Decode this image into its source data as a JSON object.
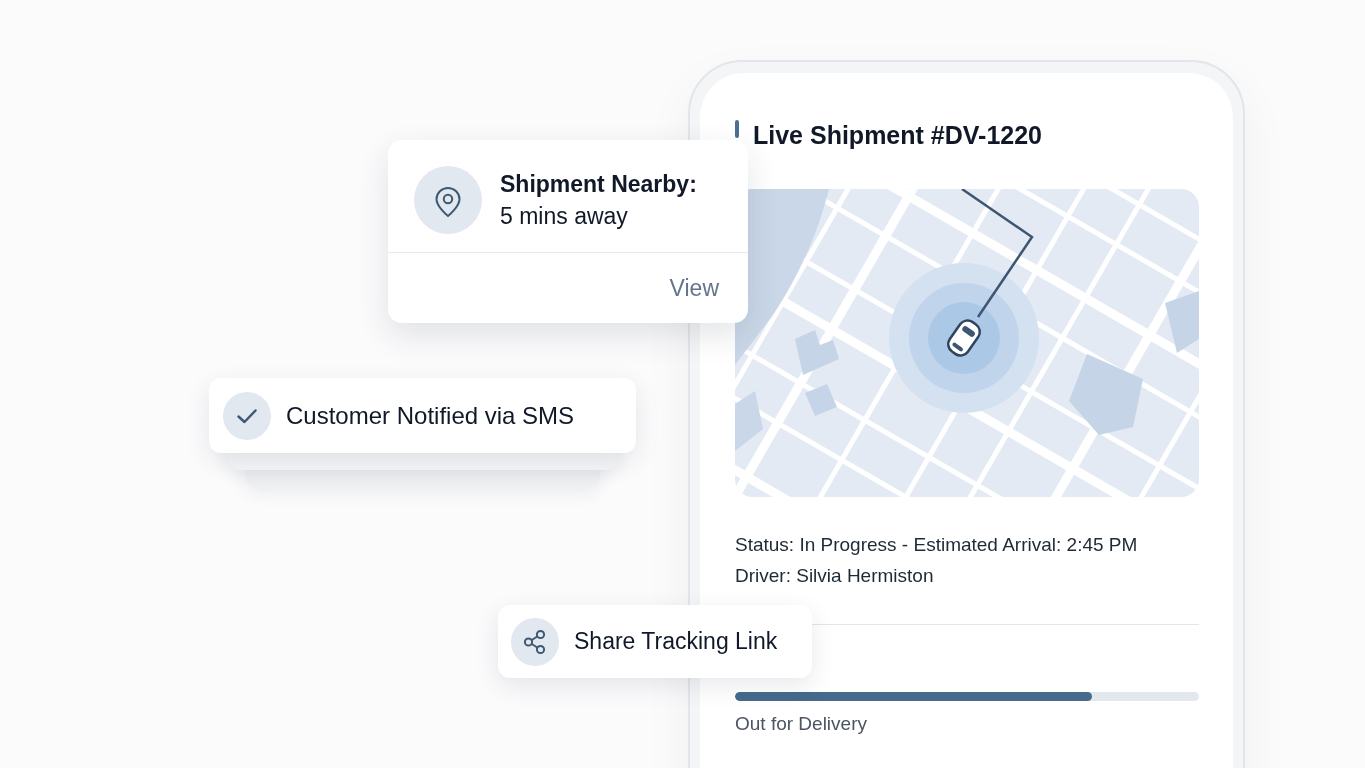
{
  "phone": {
    "title": "Live Shipment #DV-1220",
    "status": "Status: In Progress - Estimated Arrival: 2:45 PM",
    "driver": "Driver: Silvia Hermiston",
    "progress": {
      "level": 0.77,
      "label": "Out for Delivery"
    }
  },
  "notification": {
    "title": "Shipment Nearby:",
    "message": "5 mins away",
    "action": "View"
  },
  "toast": {
    "text": "Customer Notified via SMS"
  },
  "share_button": {
    "label": "Share Tracking Link"
  }
}
